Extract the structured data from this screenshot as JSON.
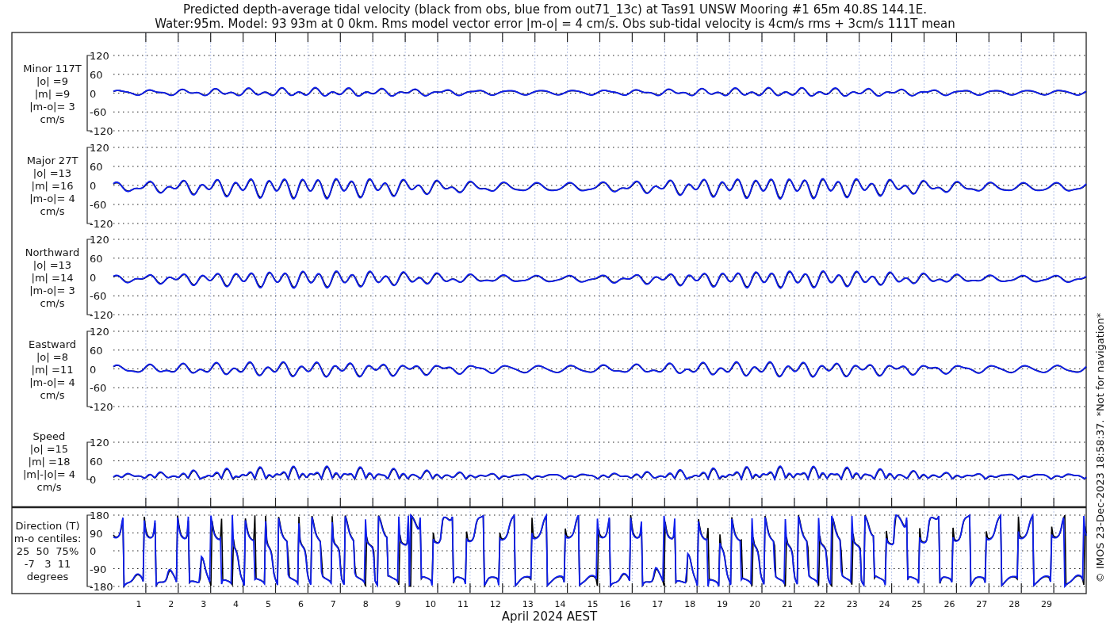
{
  "title": [
    "Predicted depth-average tidal velocity (black from obs, blue from out71_13c) at Tas91 UNSW Mooring #1 65m 40.8S 144.1E.",
    "Water:95m. Model: 93 93m at 0 0km. Rms model vector error |m-o| = 4 cm/s. Obs sub-tidal velocity is 4cm/s rms + 3cm/s 111T mean"
  ],
  "panels": [
    {
      "kind": "minor",
      "label_lines": [
        "Minor 117T",
        "|o| =9",
        "|m| =9",
        "|m-o|= 3",
        "cm/s"
      ],
      "yticks": [
        "120",
        "60",
        "0",
        "-60",
        "-120"
      ]
    },
    {
      "kind": "major",
      "label_lines": [
        "Major 27T",
        "|o| =13",
        "|m| =16",
        "|m-o|= 4",
        "cm/s"
      ],
      "yticks": [
        "120",
        "60",
        "0",
        "-60",
        "-120"
      ]
    },
    {
      "kind": "north",
      "label_lines": [
        "Northward",
        "|o| =13",
        "|m| =14",
        "|m-o|= 3",
        "cm/s"
      ],
      "yticks": [
        "120",
        "60",
        "0",
        "-60",
        "-120"
      ]
    },
    {
      "kind": "east",
      "label_lines": [
        "Eastward",
        "|o| =8",
        "|m| =11",
        "|m-o|= 4",
        "cm/s"
      ],
      "yticks": [
        "120",
        "60",
        "0",
        "-60",
        "-120"
      ]
    },
    {
      "kind": "speed",
      "label_lines": [
        "Speed",
        "|o| =15",
        "|m| =18",
        "|m|-|o|= 4",
        "cm/s"
      ],
      "yticks": [
        "120",
        "60",
        "0"
      ]
    },
    {
      "kind": "direction",
      "label_lines": [
        "Direction (T)",
        "m-o centiles:",
        "25  50  75%",
        "-7   3  11",
        "degrees"
      ],
      "yticks": [
        "180",
        "90",
        "0",
        "-90",
        "-180"
      ]
    }
  ],
  "days": [
    "1",
    "2",
    "3",
    "4",
    "5",
    "6",
    "7",
    "8",
    "9",
    "10",
    "11",
    "12",
    "13",
    "14",
    "15",
    "16",
    "17",
    "18",
    "19",
    "20",
    "21",
    "22",
    "23",
    "24",
    "25",
    "26",
    "27",
    "28",
    "29"
  ],
  "xlabel": "April 2024 AEST",
  "side_note": "© IMOS 23-Dec-2023 18:58:37. *Not for navigation*"
}
